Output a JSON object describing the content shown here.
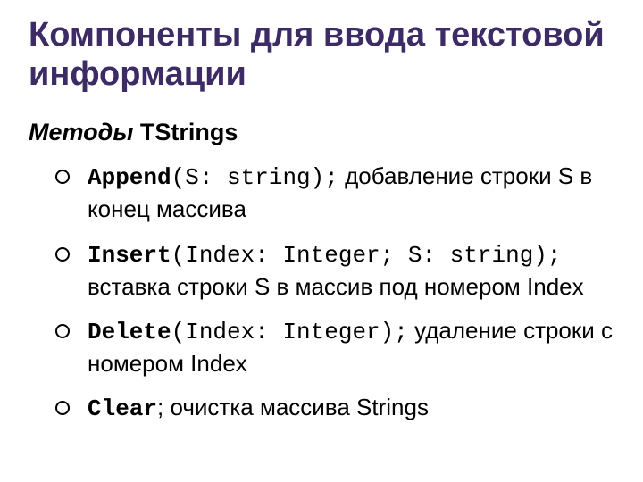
{
  "title": "Компоненты для ввода текстовой информации",
  "subtitle": {
    "italic": "Методы",
    "rest": " TStrings"
  },
  "items": [
    {
      "method": "Append",
      "sig": "(S: string);",
      "desc": " добавление строки S в конец массива"
    },
    {
      "method": "Insert",
      "sig": "(Index: Integer; S: string);",
      "desc": " вставка строки S в массив под номером Index"
    },
    {
      "method": "Delete",
      "sig": "(Index: Integer);",
      "desc": " удаление строки с номером Index"
    },
    {
      "method": "Clear",
      "sig": "",
      "desc": "; очистка массива Strings"
    }
  ]
}
